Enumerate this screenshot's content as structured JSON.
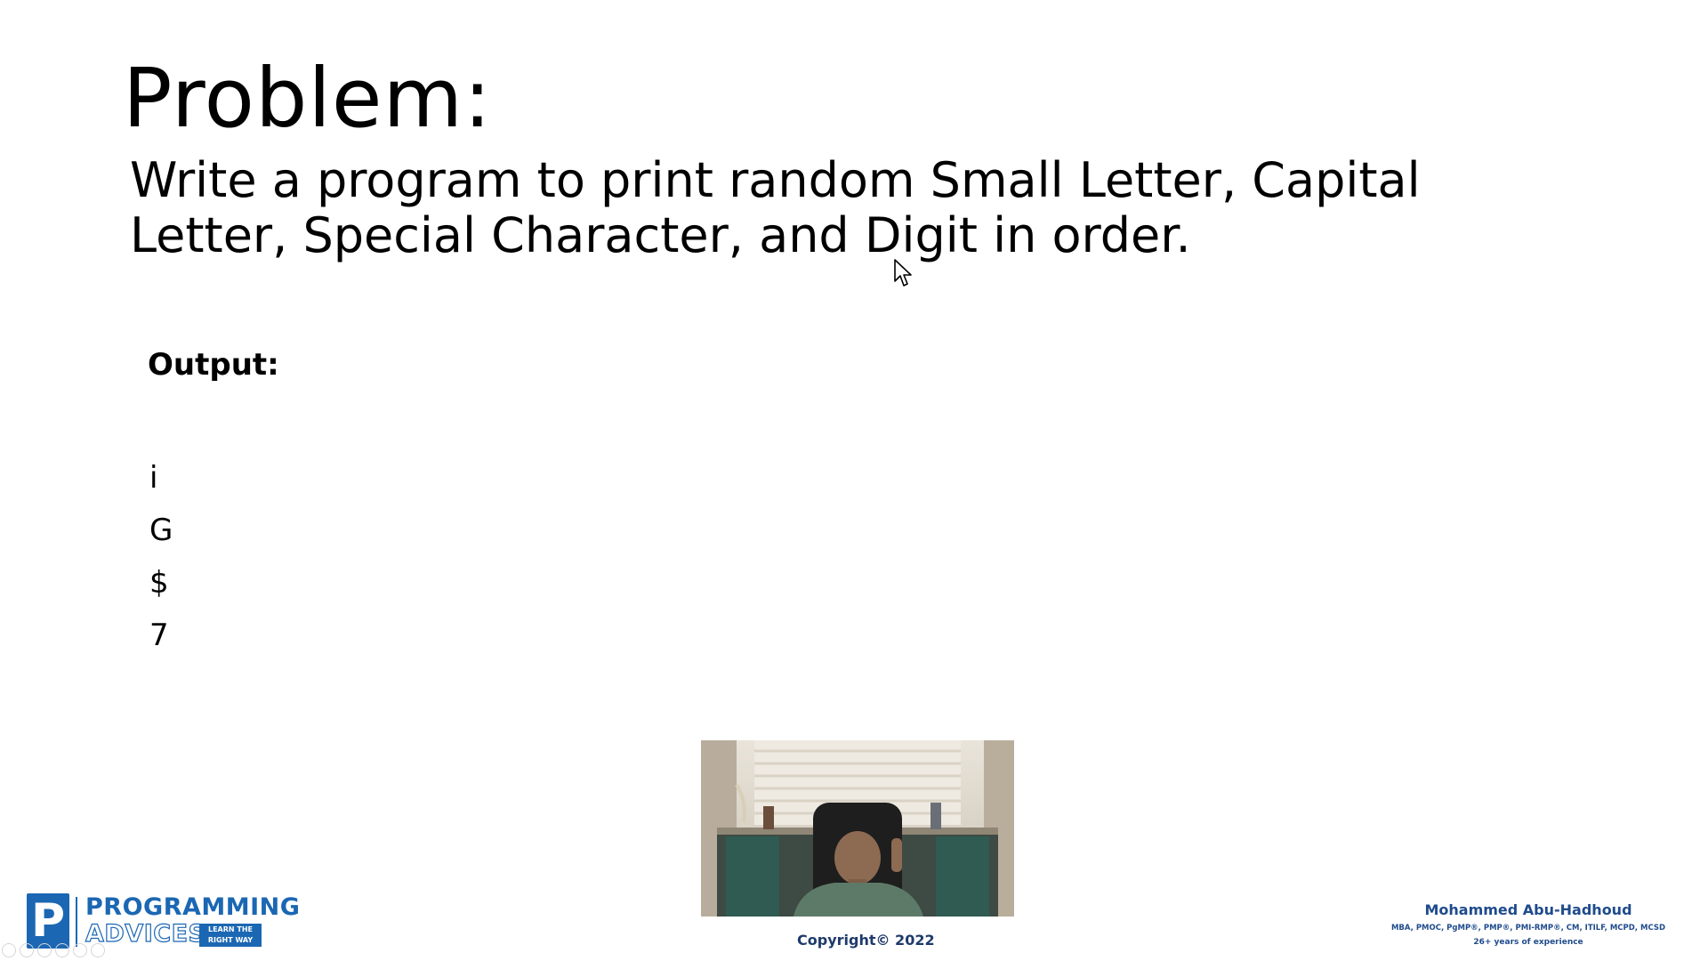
{
  "slide": {
    "title": "Problem:",
    "problem_lines": [
      "Write a program to print random  Small Letter, Capital",
      "Letter, Special Character, and Digit in order."
    ],
    "output_label": "Output:",
    "output_values": [
      "i",
      "G",
      "$",
      "7"
    ]
  },
  "footer": {
    "copyright": "Copyright© 2022",
    "logo": {
      "mark": "P",
      "line1": "PROGRAMMING",
      "line2": "ADVICES",
      "tagline_line1": "LEARN THE",
      "tagline_line2": "RIGHT WAY"
    },
    "author": {
      "name": "Mohammed Abu-Hadhoud",
      "credentials": "MBA, PMOC, PgMP®, PMP®, PMI-RMP®, CM, ITILF, MCPD, MCSD",
      "experience": "26+ years of experience"
    }
  },
  "icons": {
    "cursor": "mouse-pointer-icon",
    "webcam": "presenter-webcam",
    "toolbar": [
      "toolbar-icon-1",
      "toolbar-icon-2",
      "toolbar-icon-3",
      "toolbar-icon-4",
      "toolbar-icon-5",
      "toolbar-icon-6"
    ]
  },
  "colors": {
    "brand_blue": "#1b67b3",
    "author_blue": "#1f4b8c",
    "background": "#ffffff",
    "text": "#000000"
  }
}
